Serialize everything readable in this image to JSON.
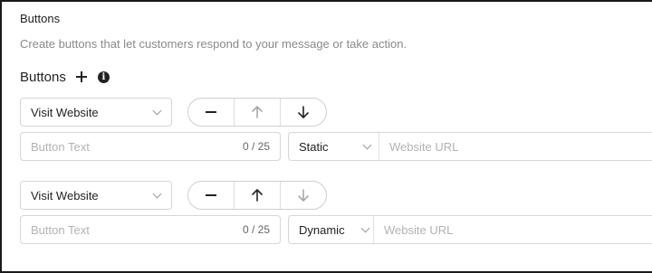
{
  "section": {
    "title": "Buttons",
    "description": "Create buttons that let customers respond to your message or take action."
  },
  "buttons_header": {
    "label": "Buttons",
    "add_icon": "plus-icon",
    "info_icon": "info-icon",
    "info_glyph": "i"
  },
  "rows": [
    {
      "type_select": "Visit Website",
      "text_placeholder": "Button Text",
      "counter": "0 / 25",
      "url_type": "Static",
      "url_placeholder": "Website URL",
      "up_enabled": false,
      "down_enabled": true
    },
    {
      "type_select": "Visit Website",
      "text_placeholder": "Button Text",
      "counter": "0 / 25",
      "url_type": "Dynamic",
      "url_placeholder": "Website URL",
      "up_enabled": true,
      "down_enabled": false
    }
  ],
  "colors": {
    "enabled_arrow": "#222222",
    "disabled_arrow": "#a8a8a8"
  }
}
